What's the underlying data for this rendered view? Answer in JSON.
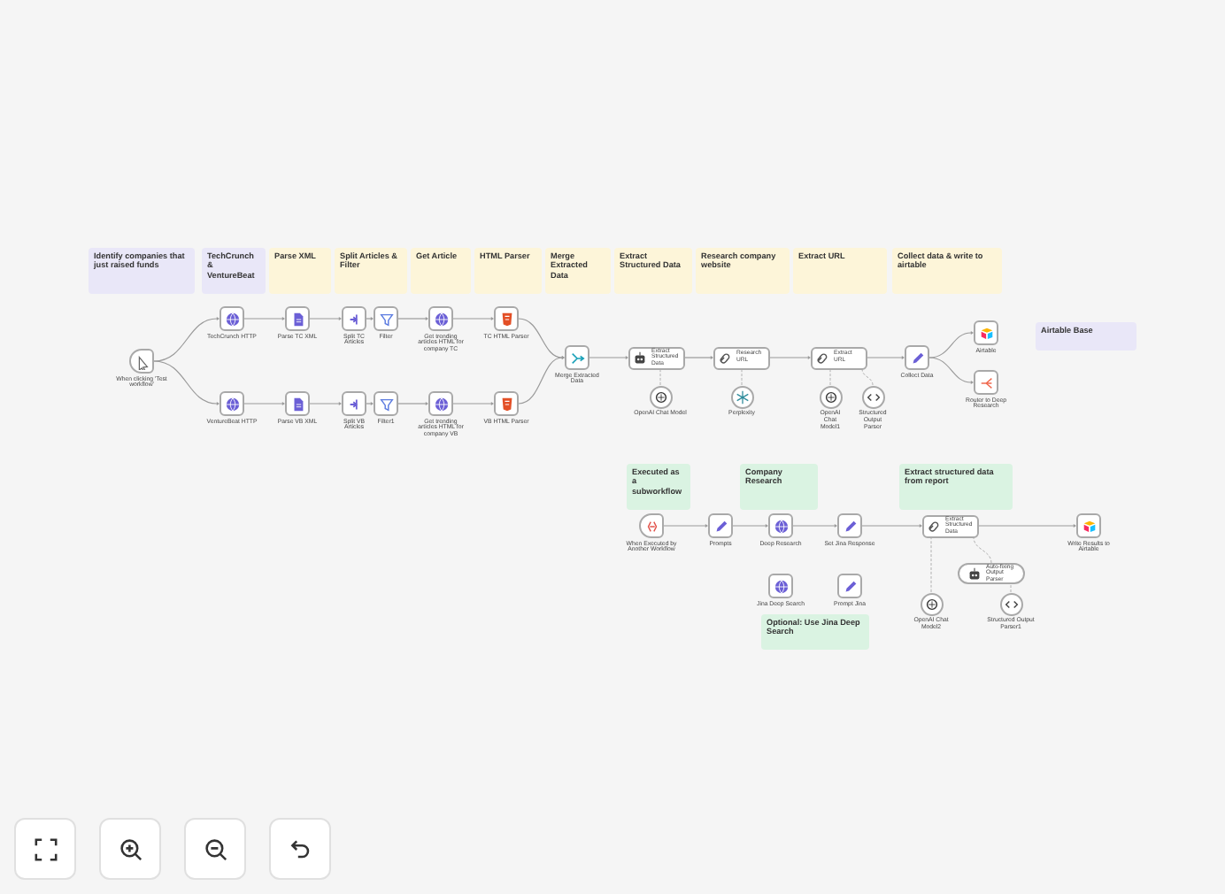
{
  "stickies": [
    {
      "title": "Identify companies that just raised funds",
      "color": "#e9e7f8"
    },
    {
      "title": "TechCrunch & VentureBeat",
      "color": "#e9e7f8"
    },
    {
      "title": "Parse XML",
      "color": "#fdf5d9"
    },
    {
      "title": "Split Articles & Filter",
      "color": "#fdf5d9"
    },
    {
      "title": "Get Article",
      "color": "#fdf5d9"
    },
    {
      "title": "HTML Parser",
      "color": "#fdf5d9"
    },
    {
      "title": "Merge Extracted Data",
      "color": "#fdf5d9"
    },
    {
      "title": "Extract Structured Data",
      "color": "#fdf5d9"
    },
    {
      "title": "Research company website",
      "color": "#fdf5d9"
    },
    {
      "title": "Extract URL",
      "color": "#fdf5d9"
    },
    {
      "title": "Collect data & write to airtable",
      "color": "#fdf5d9"
    },
    {
      "title": "Airtable Base",
      "color": "#e9e7f8"
    },
    {
      "title": "Executed as a subworkflow",
      "color": "#daf3e2"
    },
    {
      "title": "Company Research",
      "color": "#daf3e2"
    },
    {
      "title": "Extract structured data from report",
      "color": "#daf3e2"
    },
    {
      "title": "Optional: Use Jina Deep Search",
      "color": "#daf3e2"
    }
  ],
  "nodes": [
    {
      "label": "When clicking 'Test workflow'",
      "kind": "trigger"
    },
    {
      "label": "TechCrunch HTTP",
      "kind": "square"
    },
    {
      "label": "Parse TC XML",
      "kind": "square"
    },
    {
      "label": "Split TC Articles",
      "kind": "square"
    },
    {
      "label": "Filter",
      "kind": "square"
    },
    {
      "label": "Get trending articles HTML for company TC",
      "kind": "square"
    },
    {
      "label": "TC HTML Parser",
      "kind": "square"
    },
    {
      "label": "VentureBeat HTTP",
      "kind": "square"
    },
    {
      "label": "Parse VB XML",
      "kind": "square"
    },
    {
      "label": "Split VB Articles",
      "kind": "square"
    },
    {
      "label": "Filter1",
      "kind": "square"
    },
    {
      "label": "Get trending articles HTML for company VB",
      "kind": "square"
    },
    {
      "label": "VB HTML Parser",
      "kind": "square"
    },
    {
      "label": "Merge Extracted Data",
      "kind": "square"
    },
    {
      "label": "Extract Structured Data",
      "kind": "wide"
    },
    {
      "label": "OpenAI Chat Model",
      "kind": "circle"
    },
    {
      "label": "Research URL",
      "kind": "wide"
    },
    {
      "label": "Perplexity",
      "kind": "circle"
    },
    {
      "label": "Extract URL",
      "kind": "wide"
    },
    {
      "label": "OpenAI Chat Model1",
      "kind": "circle"
    },
    {
      "label": "Structured Output Parser",
      "kind": "circle"
    },
    {
      "label": "Collect Data",
      "kind": "square"
    },
    {
      "label": "Airtable",
      "kind": "square"
    },
    {
      "label": "Router to Deep Research",
      "kind": "square"
    },
    {
      "label": "When Executed by Another Workflow",
      "kind": "trigger"
    },
    {
      "label": "Prompts",
      "kind": "square"
    },
    {
      "label": "Deep Research",
      "kind": "square"
    },
    {
      "label": "Set Jina Response",
      "kind": "square"
    },
    {
      "label": "Extract Structured Data",
      "kind": "wide"
    },
    {
      "label": "Write Results to Airtable",
      "kind": "square"
    },
    {
      "label": "Jina Deep Search",
      "kind": "square"
    },
    {
      "label": "Prompt Jina",
      "kind": "square"
    },
    {
      "label": "Auto-fixing Output Parser",
      "kind": "pill"
    },
    {
      "label": "OpenAI Chat Model2",
      "kind": "circle"
    },
    {
      "label": "Structured Output Parser1",
      "kind": "circle"
    }
  ],
  "controls": [
    {
      "kind": "fit"
    },
    {
      "kind": "zoom-in"
    },
    {
      "kind": "zoom-out"
    },
    {
      "kind": "undo"
    }
  ]
}
